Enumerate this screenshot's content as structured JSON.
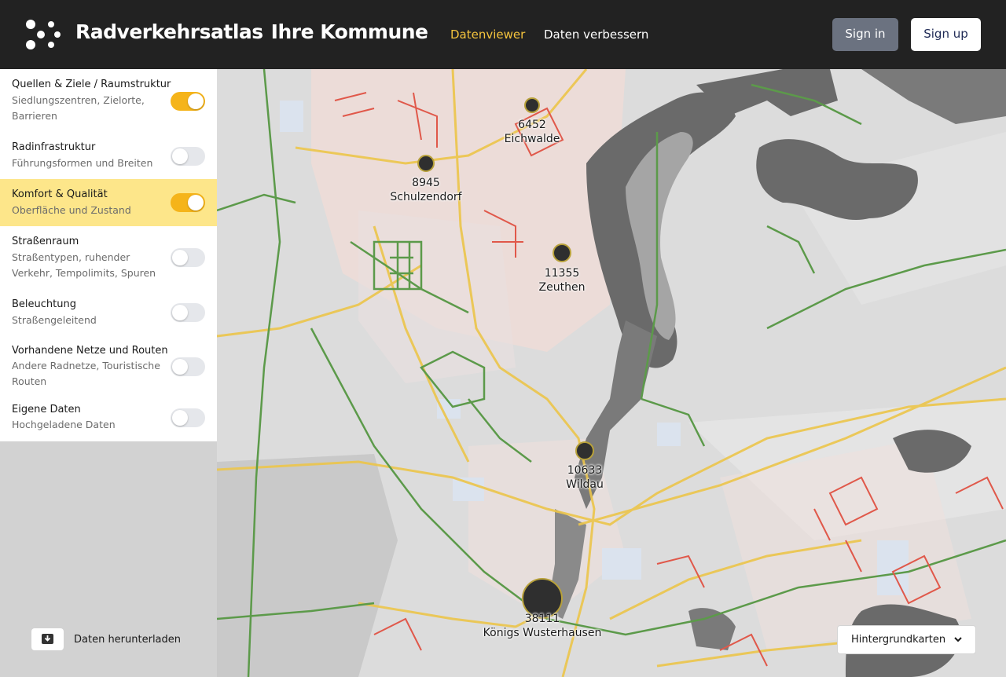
{
  "header": {
    "title_part1": "Radverkehrsatlas",
    "title_part2": "Ihre Kommune",
    "nav": [
      {
        "label": "Datenviewer",
        "active": true
      },
      {
        "label": "Daten verbessern",
        "active": false
      }
    ],
    "sign_in": "Sign in",
    "sign_up": "Sign up"
  },
  "sidebar": {
    "layers": [
      {
        "title": "Quellen & Ziele / Raumstruktur",
        "description": "Siedlungszentren, Zielorte, Barrieren",
        "enabled": true,
        "highlighted": false
      },
      {
        "title": "Radinfrastruktur",
        "description": "Führungsformen und Breiten",
        "enabled": false,
        "highlighted": false
      },
      {
        "title": "Komfort & Qualität",
        "description": "Oberfläche und Zustand",
        "enabled": true,
        "highlighted": true
      },
      {
        "title": "Straßenraum",
        "description": "Straßentypen, ruhender Verkehr, Tempolimits, Spuren",
        "enabled": false,
        "highlighted": false
      },
      {
        "title": "Beleuchtung",
        "description": "Straßengeleitend",
        "enabled": false,
        "highlighted": false
      },
      {
        "title": "Vorhandene Netze und Routen",
        "description": "Andere Radnetze, Touristische Routen",
        "enabled": false,
        "highlighted": false
      },
      {
        "title": "Eigene Daten",
        "description": "Hochgeladene Daten",
        "enabled": false,
        "highlighted": false
      }
    ],
    "download_label": "Daten herunterladen",
    "download_icon": "download-icon"
  },
  "map": {
    "cities": [
      {
        "population": "6452",
        "name": "Eichwalde"
      },
      {
        "population": "8945",
        "name": "Schulzendorf"
      },
      {
        "population": "11355",
        "name": "Zeuthen"
      },
      {
        "population": "10633",
        "name": "Wildau"
      },
      {
        "population": "38111",
        "name": "Königs Wusterhausen"
      }
    ],
    "background_maps_label": "Hintergrundkarten",
    "colors": {
      "good": "#5c9a4a",
      "medium": "#ecc54a",
      "poor": "#e0584a",
      "water": "#6a6a6a",
      "land": "#dcdcdc"
    }
  }
}
